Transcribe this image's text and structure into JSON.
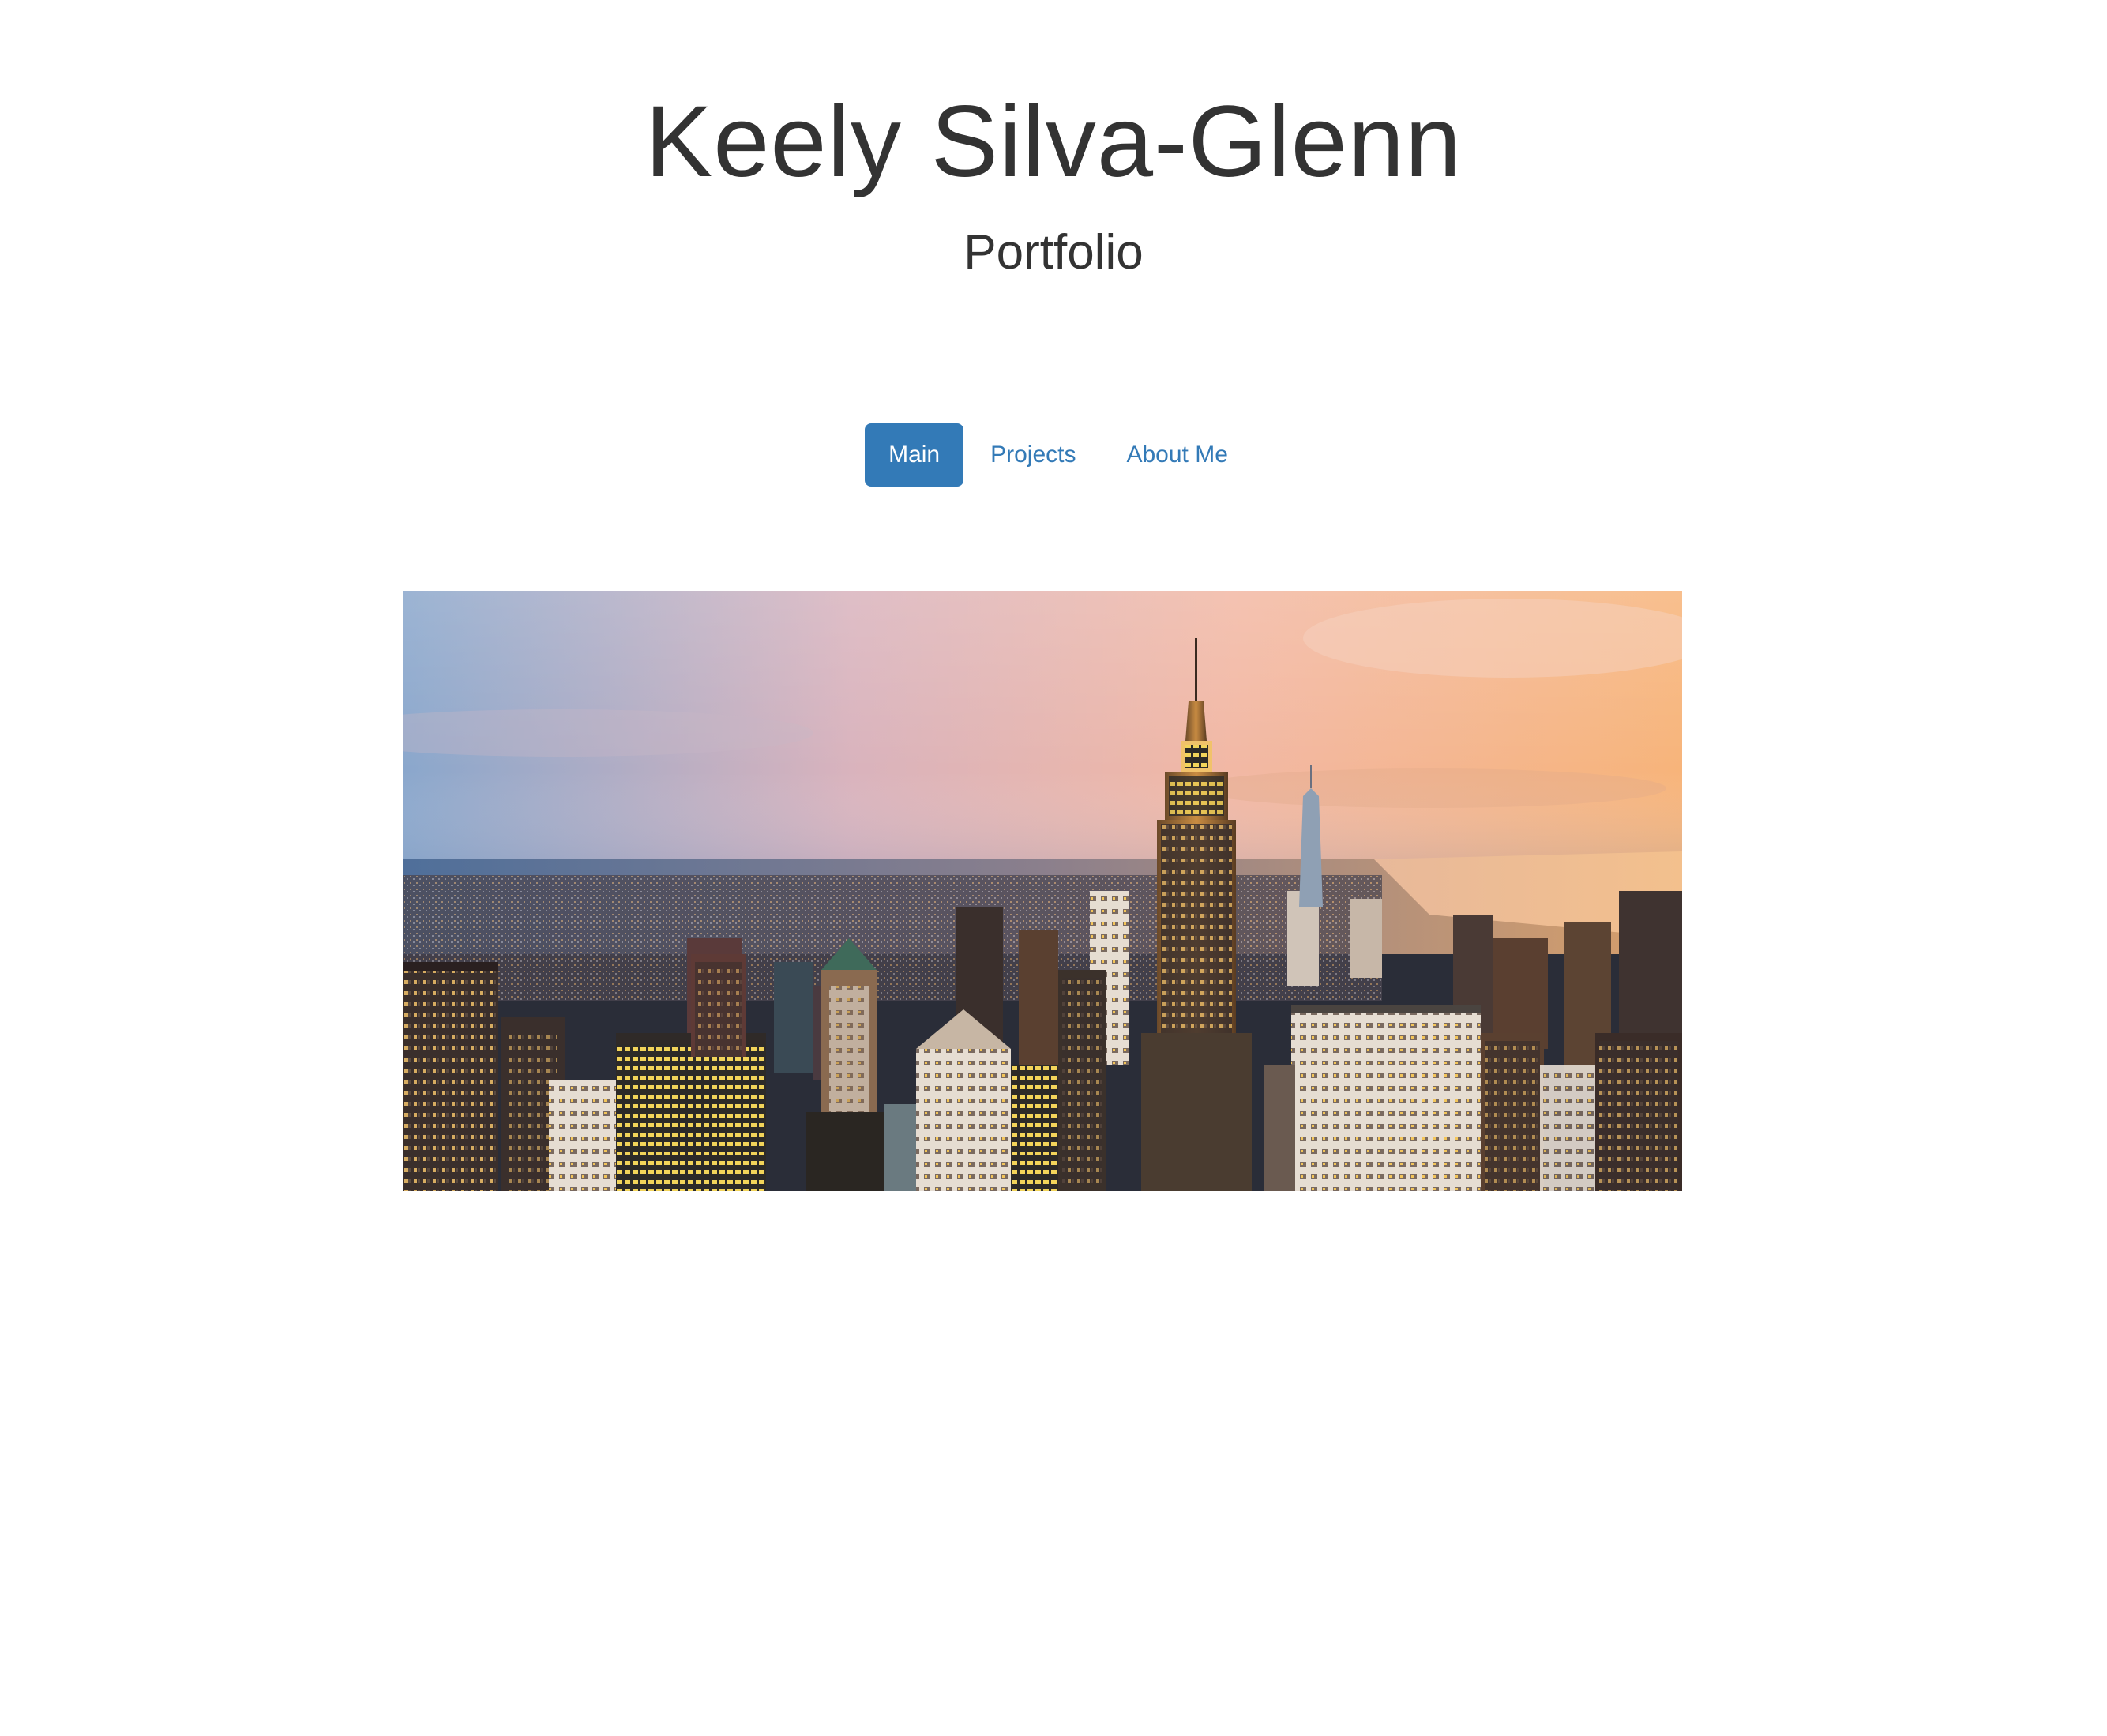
{
  "header": {
    "title": "Keely Silva-Glenn",
    "subtitle": "Portfolio"
  },
  "nav": {
    "items": [
      {
        "label": "Main",
        "active": true
      },
      {
        "label": "Projects",
        "active": false
      },
      {
        "label": "About Me",
        "active": false
      }
    ]
  },
  "colors": {
    "primary": "#337ab7",
    "text": "#333333",
    "background": "#ffffff"
  },
  "hero": {
    "icon": "city-skyline-image"
  }
}
